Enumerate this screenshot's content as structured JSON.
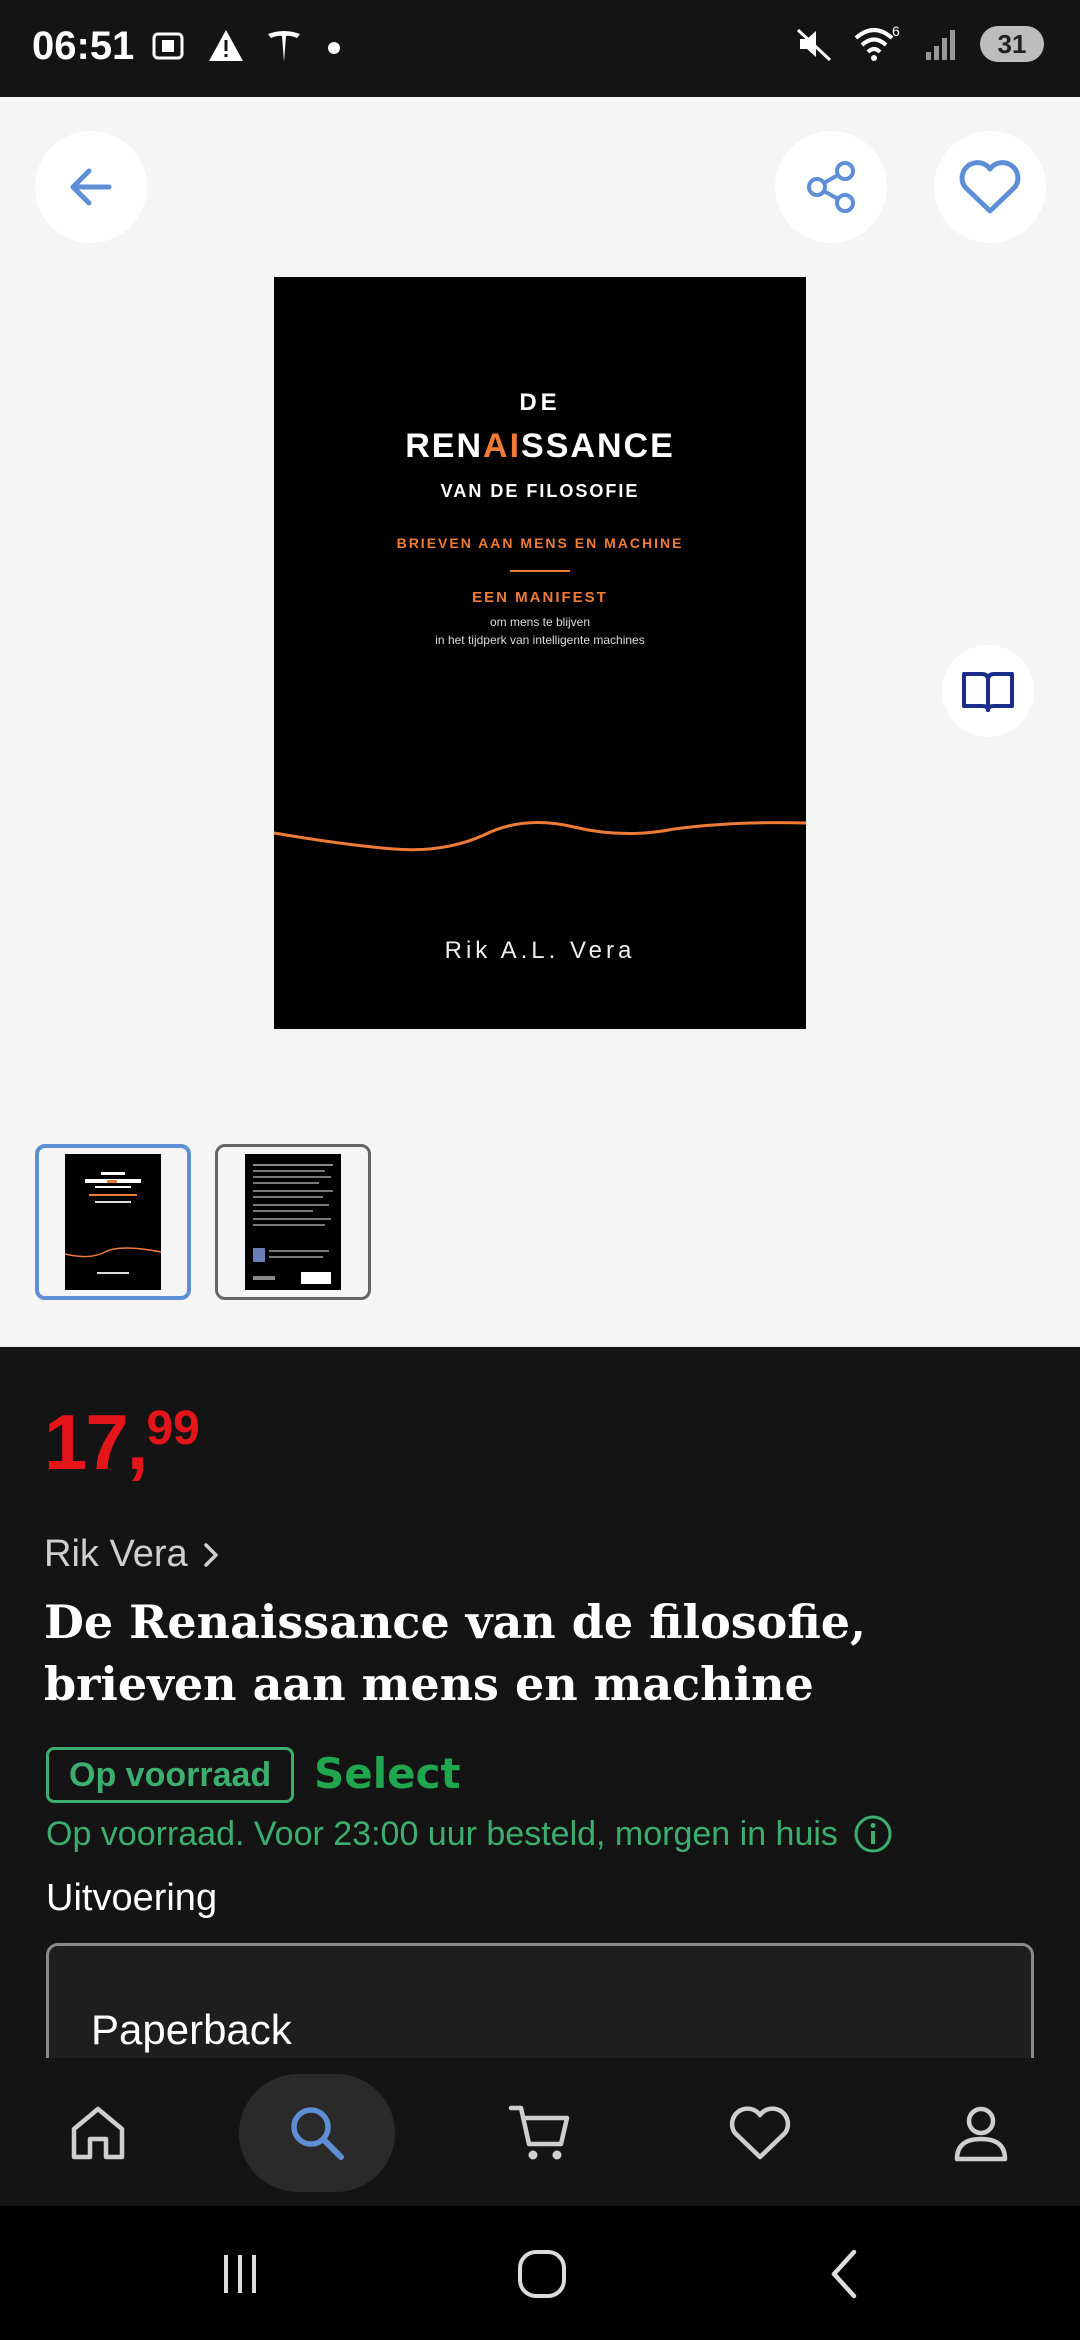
{
  "status_bar": {
    "time": "06:51",
    "battery": "31",
    "wifi_badge": "6"
  },
  "cover": {
    "line_de": "DE",
    "title_pre": "REN",
    "title_ai": "AI",
    "title_post": "SSANCE",
    "subtitle": "VAN DE FILOSOFIE",
    "tagline": "BRIEVEN AAN MENS EN MACHINE",
    "manifest": "EEN MANIFEST",
    "line1": "om mens te blijven",
    "line2": "in het tijdperk van intelligente machines",
    "author": "Rik A.L. Vera",
    "accent_color": "#ef7c36"
  },
  "product": {
    "price_main": "17,",
    "price_cents": "99",
    "author": "Rik Vera",
    "title": "De Renaissance van de filosofie, brieven aan mens en machine",
    "stock_badge": "Op voorraad",
    "select_label": "Select",
    "delivery": "Op voorraad. Voor 23:00 uur besteld, morgen in huis",
    "format_label": "Uitvoering",
    "format_value": "Paperback"
  },
  "colors": {
    "price": "#e4141b",
    "stock": "#3cae6f",
    "select": "#1fa64e",
    "icon_blue": "#5e8fd6"
  },
  "icons": {
    "back": "arrow-left-icon",
    "share": "share-icon",
    "favorite": "heart-icon",
    "preview": "book-open-icon"
  },
  "bottom_nav": [
    "home-icon",
    "search-icon",
    "cart-icon",
    "heart-icon",
    "profile-icon"
  ]
}
